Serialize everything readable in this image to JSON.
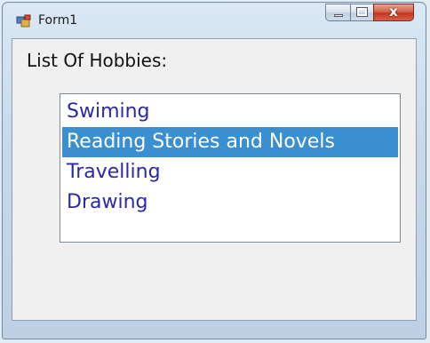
{
  "window": {
    "title": "Form1",
    "caption_buttons": {
      "minimize": "minimize",
      "maximize": "maximize",
      "close": "x"
    }
  },
  "form": {
    "label": "List Of Hobbies:",
    "listbox": {
      "items": [
        {
          "label": "Swiming",
          "selected": false
        },
        {
          "label": "Reading Stories and Novels",
          "selected": true
        },
        {
          "label": "Travelling",
          "selected": false
        },
        {
          "label": "Drawing",
          "selected": false
        }
      ]
    }
  },
  "colors": {
    "selection_background": "#3a8fd0",
    "item_text": "#2a2aa8",
    "selected_text": "#ffffff",
    "close_button": "#c2361f"
  }
}
